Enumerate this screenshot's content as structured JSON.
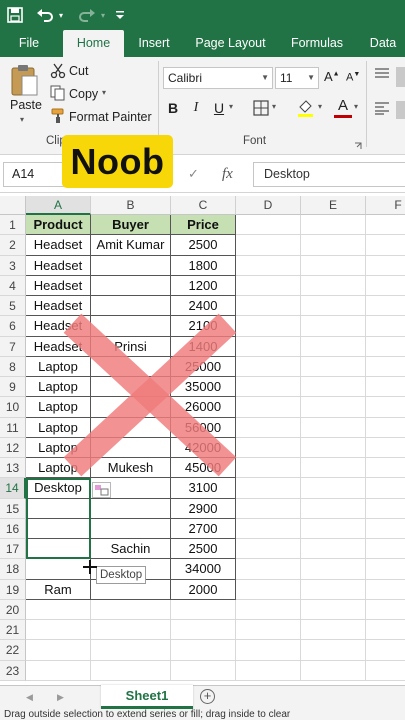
{
  "tabs": [
    "File",
    "Home",
    "Insert",
    "Page Layout",
    "Formulas",
    "Data"
  ],
  "active_tab": "Home",
  "clipboard": {
    "paste_label": "Paste",
    "cut_label": "Cut",
    "copy_label": "Copy",
    "format_painter_label": "Format Painter",
    "group_label": "Clip"
  },
  "font": {
    "font_name": "Calibri",
    "font_size": "11",
    "bold": "B",
    "italic": "I",
    "underline": "U",
    "font_color_glyph": "A",
    "highlight_glyph": "A",
    "group_label": "Font",
    "red": "#c00000",
    "yellow": "#ffff00"
  },
  "badge": {
    "text": "Noob",
    "color": "#f7d708"
  },
  "formula_bar": {
    "name_box": "A14",
    "cancel": "✕",
    "enter": "✓",
    "fx": "fx",
    "value": "Desktop"
  },
  "columns": [
    "A",
    "B",
    "C",
    "D",
    "E",
    "F"
  ],
  "selected_column": "A",
  "rows": [
    "1",
    "2",
    "3",
    "4",
    "5",
    "6",
    "7",
    "8",
    "9",
    "10",
    "11",
    "12",
    "13",
    "14",
    "15",
    "16",
    "17",
    "18",
    "19",
    "20",
    "21",
    "22",
    "23"
  ],
  "selected_row": "14",
  "table": {
    "headers": [
      "Product",
      "Buyer",
      "Price"
    ],
    "header_fill": "#c6e0b4",
    "data": [
      [
        "Headset",
        "Amit Kumar",
        "2500"
      ],
      [
        "Headset",
        "",
        "1800"
      ],
      [
        "Headset",
        "",
        "1200"
      ],
      [
        "Headset",
        "",
        "2400"
      ],
      [
        "Headset",
        "",
        "2100"
      ],
      [
        "Headset",
        "Prinsi",
        "1400"
      ],
      [
        "Laptop",
        "",
        "25000"
      ],
      [
        "Laptop",
        "",
        "35000"
      ],
      [
        "Laptop",
        "",
        "26000"
      ],
      [
        "Laptop",
        "",
        "56000"
      ],
      [
        "Laptop",
        "",
        "42000"
      ],
      [
        "Laptop",
        "Mukesh",
        "45000"
      ],
      [
        "Desktop",
        "",
        "3100"
      ],
      [
        "",
        "",
        "2900"
      ],
      [
        "",
        "",
        "2700"
      ],
      [
        "",
        "Sachin",
        "2500"
      ],
      [
        "",
        "",
        "34000"
      ],
      [
        "Ram",
        "",
        "2000"
      ]
    ]
  },
  "drag_tooltip": "Desktop",
  "sheet": {
    "name": "Sheet1",
    "add": "+"
  },
  "accent": "#217346",
  "x_mark_color": "#f07b7b",
  "status_text": "Drag outside selection to extend series or fill; drag inside to clear"
}
